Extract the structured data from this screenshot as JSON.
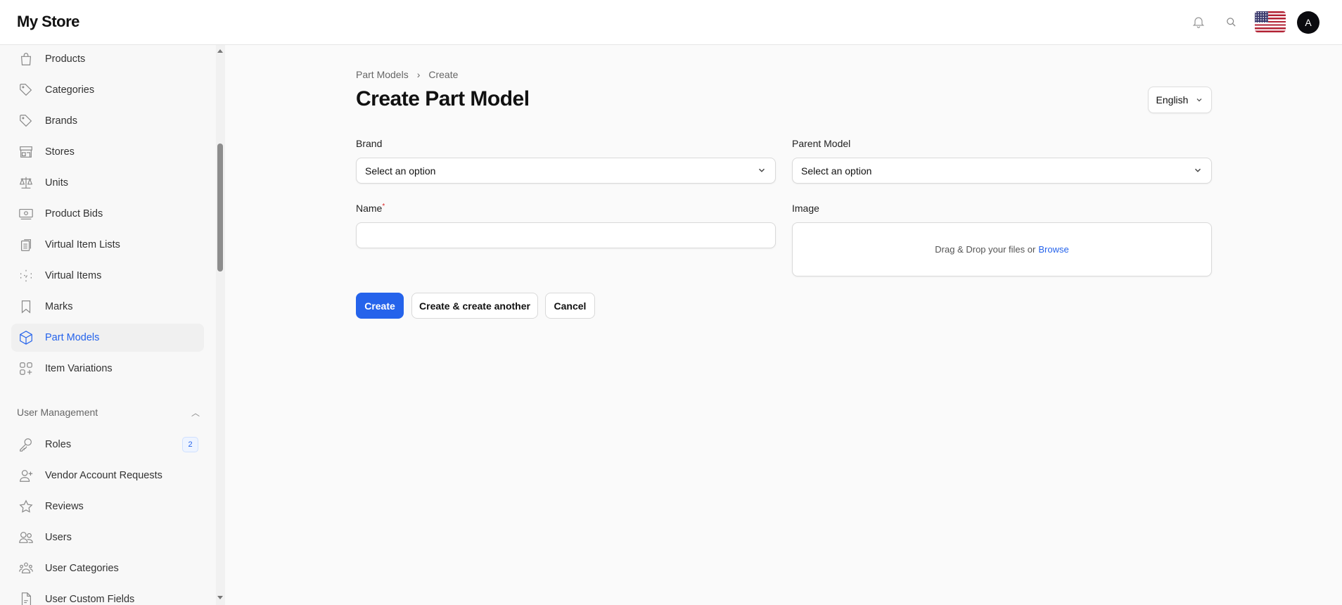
{
  "header": {
    "app_title": "My Store",
    "avatar_initial": "A",
    "icons": [
      "bell-icon",
      "search-icon",
      "us-flag-icon"
    ]
  },
  "sidebar": {
    "items": [
      {
        "label": "Products",
        "icon": "shopping-bag-icon"
      },
      {
        "label": "Categories",
        "icon": "tag-icon"
      },
      {
        "label": "Brands",
        "icon": "tag-icon"
      },
      {
        "label": "Stores",
        "icon": "store-icon"
      },
      {
        "label": "Units",
        "icon": "scale-icon"
      },
      {
        "label": "Product Bids",
        "icon": "banknote-icon"
      },
      {
        "label": "Virtual Item Lists",
        "icon": "clipboard-list-icon"
      },
      {
        "label": "Virtual Items",
        "icon": "dashed-cube-icon"
      },
      {
        "label": "Marks",
        "icon": "bookmark-icon"
      },
      {
        "label": "Part Models",
        "icon": "cube-icon",
        "active": true
      },
      {
        "label": "Item Variations",
        "icon": "squares-plus-icon"
      }
    ],
    "group": {
      "label": "User Management",
      "items": [
        {
          "label": "Roles",
          "icon": "key-icon",
          "badge": "2"
        },
        {
          "label": "Vendor Account Requests",
          "icon": "user-plus-icon"
        },
        {
          "label": "Reviews",
          "icon": "star-icon"
        },
        {
          "label": "Users",
          "icon": "users-icon"
        },
        {
          "label": "User Categories",
          "icon": "user-group-icon"
        },
        {
          "label": "User Custom Fields",
          "icon": "document-icon"
        }
      ]
    }
  },
  "main": {
    "breadcrumb": [
      "Part Models",
      "Create"
    ],
    "title": "Create Part Model",
    "language": "English",
    "form": {
      "brand": {
        "label": "Brand",
        "value": "Select an option"
      },
      "parent_model": {
        "label": "Parent Model",
        "value": "Select an option"
      },
      "name": {
        "label": "Name",
        "required_mark": "*",
        "value": ""
      },
      "image": {
        "label": "Image",
        "drop_text": "Drag & Drop your files or",
        "browse": "Browse"
      }
    },
    "buttons": {
      "create": "Create",
      "create_another": "Create & create another",
      "cancel": "Cancel"
    },
    "accent": "#2563eb"
  }
}
